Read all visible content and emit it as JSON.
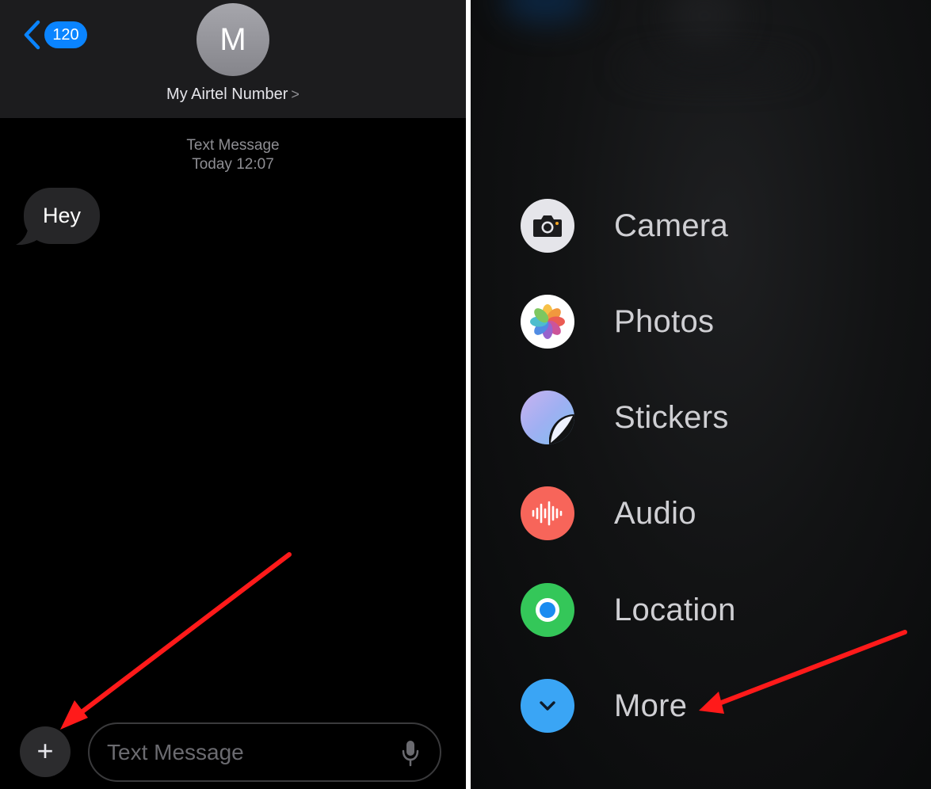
{
  "conversation": {
    "back_count": "120",
    "avatar_initial": "M",
    "contact_name": "My Airtel Number",
    "contact_arrow": ">",
    "meta_type": "Text Message",
    "meta_time": "Today 12:07",
    "messages": [
      {
        "text": "Hey",
        "direction": "incoming"
      }
    ],
    "plus_glyph": "+",
    "compose_placeholder": "Text Message"
  },
  "menu": {
    "items": [
      {
        "label": "Camera",
        "icon": "camera-icon",
        "color": "#e5e5ea"
      },
      {
        "label": "Photos",
        "icon": "photos-icon",
        "color": "#ffffff"
      },
      {
        "label": "Stickers",
        "icon": "stickers-icon",
        "color": "#a9b8f5"
      },
      {
        "label": "Audio",
        "icon": "audio-waveform-icon",
        "color": "#f7655a"
      },
      {
        "label": "Location",
        "icon": "location-icon",
        "color": "#34c759"
      },
      {
        "label": "More",
        "icon": "chevron-down-icon",
        "color": "#3aa5f5"
      }
    ]
  },
  "colors": {
    "accent_blue": "#0a84ff",
    "annotation_red": "#ff1a1a",
    "bubble_gray": "#262628",
    "nav_bar": "#1c1c1e"
  }
}
